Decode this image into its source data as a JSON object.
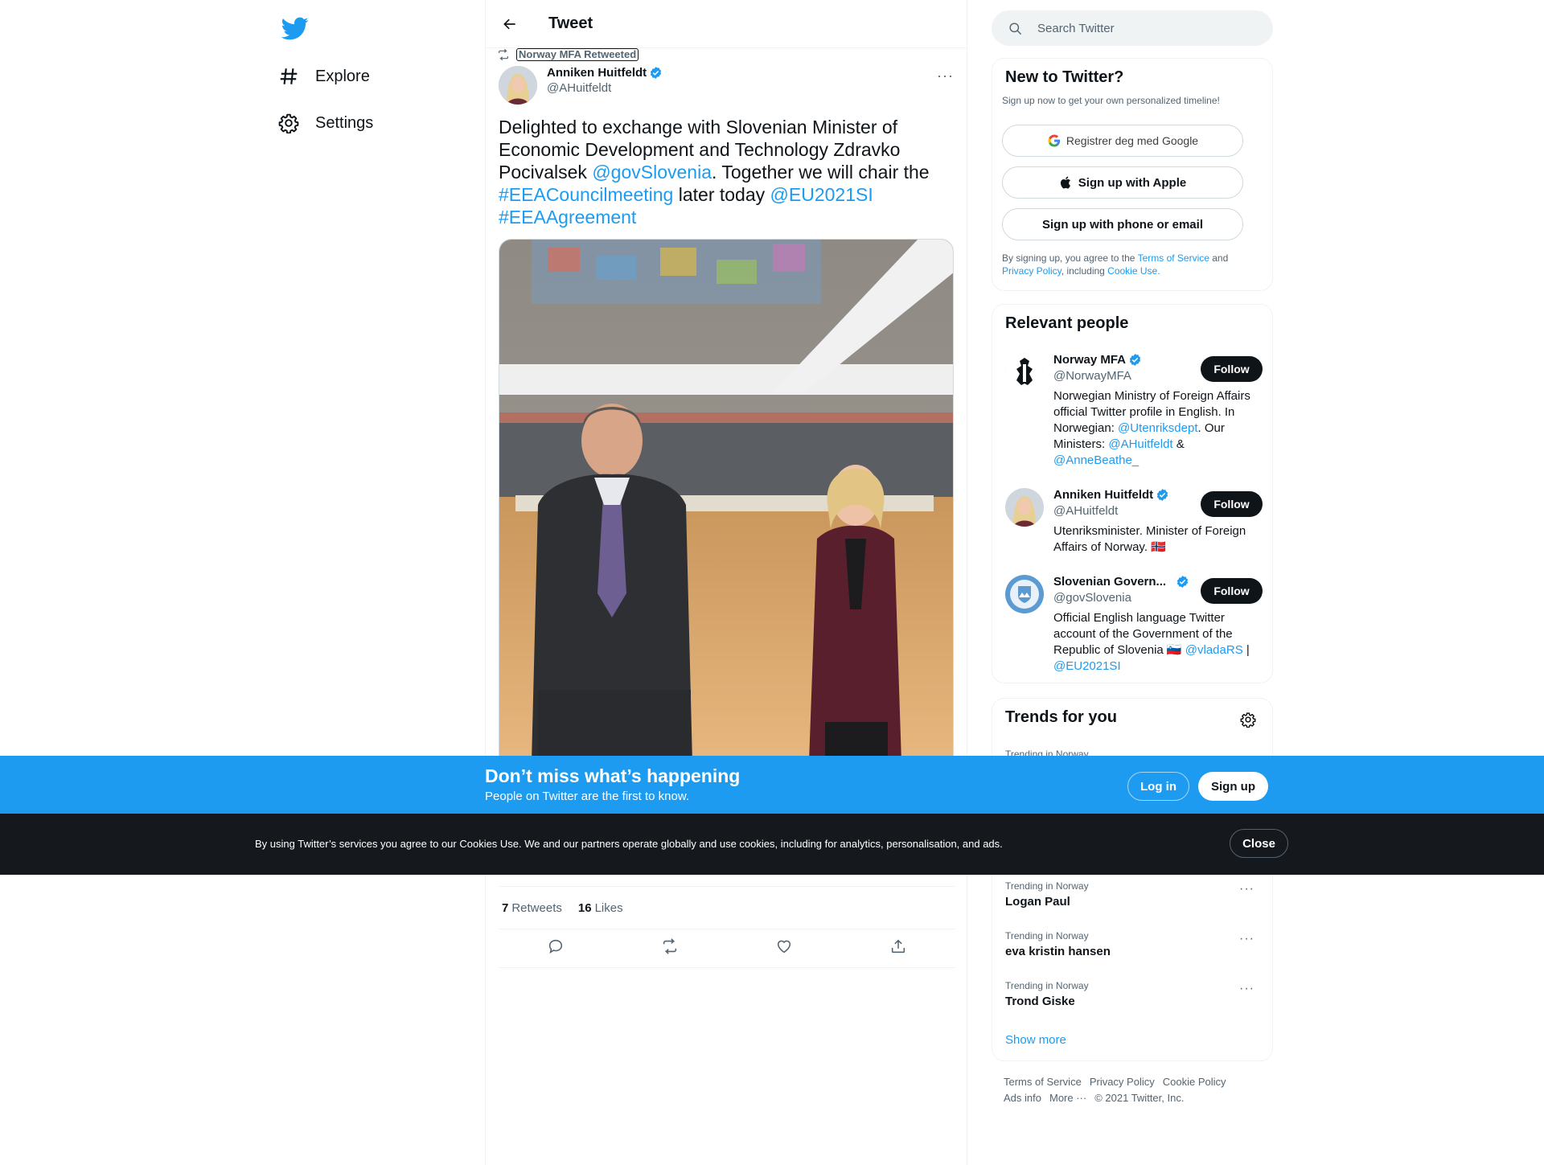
{
  "colors": {
    "brand": "#1d9bf0",
    "dark": "#0f1419",
    "muted": "#536471",
    "cookie_bg": "#15181c"
  },
  "nav": {
    "logo_icon": "twitter-bird-icon",
    "items": [
      {
        "label": "Explore",
        "icon": "hashtag-icon"
      },
      {
        "label": "Settings",
        "icon": "gear-icon"
      }
    ]
  },
  "header": {
    "title": "Tweet",
    "back_icon": "arrow-left-icon"
  },
  "tweet": {
    "retweeted_by": "Norway MFA Retweeted",
    "author_name": "Anniken Huitfeldt",
    "author_handle": "@AHuitfeldt",
    "more": "···",
    "text_parts": {
      "t1": "Delighted to exchange with Slovenian Minister of Economic Development and Technology Zdravko Pocivalsek ",
      "m1": "@govSlovenia",
      "t2": ". Together we will chair the ",
      "h1": "#EEACouncilmeeting",
      "t3": " later today ",
      "m2": "@EU2021SI",
      "h2": "#EEAAgreement"
    },
    "retweets_count": "7",
    "retweets_label": "Retweets",
    "likes_count": "16",
    "likes_label": "Likes"
  },
  "search": {
    "placeholder": "Search Twitter"
  },
  "new_to_twitter": {
    "title": "New to Twitter?",
    "subtitle": "Sign up now to get your own personalized timeline!",
    "google_label": "Registrer deg med Google",
    "apple_label": "Sign up with Apple",
    "phone_label": "Sign up with phone or email",
    "terms_pre": "By signing up, you agree to the ",
    "terms_link": "Terms of Service",
    "terms_and": " and ",
    "privacy_link": "Privacy Policy",
    "terms_including": ", including ",
    "cookie_link": "Cookie Use."
  },
  "relevant_people": {
    "title": "Relevant people",
    "follow_label": "Follow",
    "people": [
      {
        "name": "Norway MFA",
        "handle": "@NorwayMFA",
        "bio_1": "Norwegian Ministry of Foreign Affairs official Twitter profile in English. In Norwegian: ",
        "link_1": "@Utenriksdept",
        "bio_2": ". Our Ministers: ",
        "link_2": "@AHuitfeldt",
        "bio_3": " & ",
        "link_3": "@AnneBeathe_"
      },
      {
        "name": "Anniken Huitfeldt",
        "handle": "@AHuitfeldt",
        "bio_1": "Utenriksminister. Minister of Foreign Affairs of Norway. ",
        "flag": "🇳🇴"
      },
      {
        "name": "Slovenian Govern...",
        "handle": "@govSlovenia",
        "bio_1": "Official English language Twitter account of the Government of the Republic of Slovenia ",
        "flag": "🇸🇮",
        "link_1": "@vladaRS",
        "bio_2": " | ",
        "link_2": "@EU2021SI"
      }
    ]
  },
  "trends": {
    "title": "Trends for you",
    "hidden_meta": "Trending in Norway",
    "items": [
      {
        "meta": "Trending in Norway",
        "name": "Logan Paul"
      },
      {
        "meta": "Trending in Norway",
        "name": "eva kristin hansen"
      },
      {
        "meta": "Trending in Norway",
        "name": "Trond Giske"
      }
    ],
    "more": "···",
    "show_more": "Show more"
  },
  "footer": {
    "terms": "Terms of Service",
    "privacy": "Privacy Policy",
    "cookie": "Cookie Policy",
    "ads": "Ads info",
    "more": "More ···",
    "copyright": "© 2021 Twitter, Inc."
  },
  "banner": {
    "title": "Don’t miss what’s happening",
    "subtitle": "People on Twitter are the first to know.",
    "login": "Log in",
    "signup": "Sign up"
  },
  "cookie_bar": {
    "text": "By using Twitter’s services you agree to our Cookies Use. We and our partners operate globally and use cookies, including for analytics, personalisation, and ads.",
    "close": "Close"
  }
}
